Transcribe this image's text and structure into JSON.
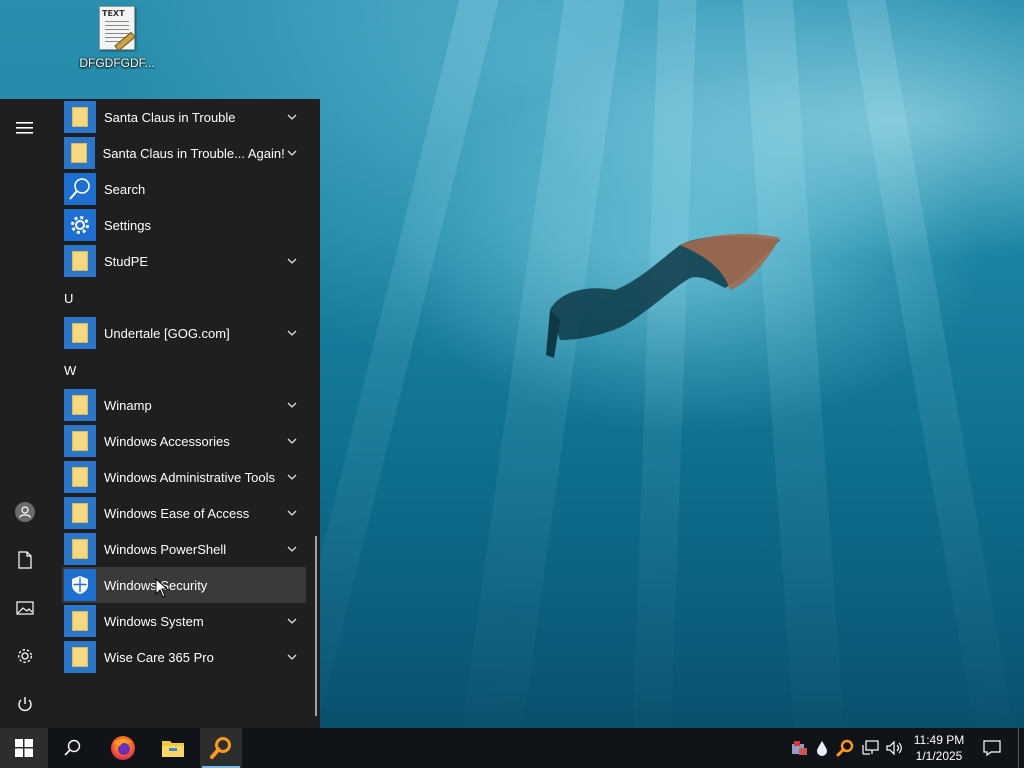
{
  "desktop": {
    "icon_label": "DFGDFGDF...",
    "icon_tag": "TEXT"
  },
  "start_menu": {
    "apps": [
      {
        "label": "Santa Claus in Trouble",
        "icon": "folder-icon",
        "expandable": true
      },
      {
        "label": "Santa Claus in Trouble... Again!",
        "icon": "folder-icon",
        "expandable": true
      },
      {
        "label": "Search",
        "icon": "search-icon",
        "expandable": false
      },
      {
        "label": "Settings",
        "icon": "gear-icon",
        "expandable": false
      },
      {
        "label": "StudPE",
        "icon": "folder-icon",
        "expandable": true
      },
      {
        "label": "Undertale [GOG.com]",
        "icon": "folder-icon",
        "expandable": true
      },
      {
        "label": "Winamp",
        "icon": "folder-icon",
        "expandable": true
      },
      {
        "label": "Windows Accessories",
        "icon": "folder-icon",
        "expandable": true
      },
      {
        "label": "Windows Administrative Tools",
        "icon": "folder-icon",
        "expandable": true
      },
      {
        "label": "Windows Ease of Access",
        "icon": "folder-icon",
        "expandable": true
      },
      {
        "label": "Windows PowerShell",
        "icon": "folder-icon",
        "expandable": true
      },
      {
        "label": "Windows Security",
        "icon": "shield-icon",
        "expandable": false
      },
      {
        "label": "Windows System",
        "icon": "folder-icon",
        "expandable": true
      },
      {
        "label": "Wise Care 365 Pro",
        "icon": "folder-icon",
        "expandable": true
      }
    ],
    "section_letters": [
      "U",
      "W"
    ],
    "hovered_item": "Windows Security",
    "rail": [
      "hamburger-menu-icon",
      "user-avatar-icon",
      "documents-icon",
      "pictures-icon",
      "settings-gear-icon",
      "power-icon"
    ]
  },
  "taskbar": {
    "pinned": [
      "start-button",
      "search-button",
      "firefox",
      "file-explorer",
      "search-app"
    ],
    "tray_icons": [
      "network-tool-icon",
      "droplet-icon",
      "search-app-tray-icon",
      "network-icon",
      "volume-icon"
    ],
    "time": "11:49 PM",
    "date": "1/1/2025"
  },
  "colors": {
    "menu_bg": "#1f1f1f",
    "taskbar_bg": "#101317",
    "accent": "#2b76c8",
    "active_underline": "#76b9ed"
  }
}
